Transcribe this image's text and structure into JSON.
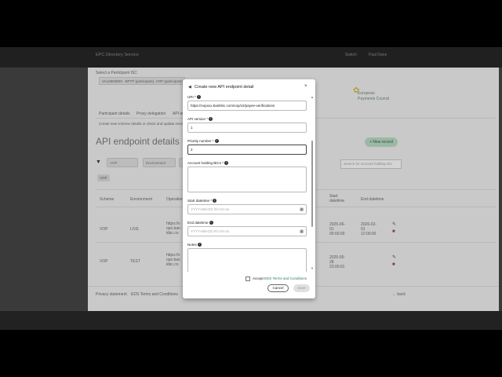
{
  "app": {
    "title": "EPC Directory Service",
    "user_switch": "Switch",
    "user_name": "Paul Dane",
    "brand_line1": "European",
    "brand_line2": "Payments Council"
  },
  "background": {
    "participant_label": "Select a Participant ISC",
    "participant_value": "VAL5903800 - BFTP (participant), VOP (participant)",
    "tabs": [
      "Participant details",
      "Proxy delegation",
      "API endpoints"
    ],
    "description": "Create new scheme details or check and update existing ones",
    "page_title": "API endpoint details (2)",
    "new_record": "+ New record",
    "filters": [
      "VOP",
      "Environment",
      "..."
    ],
    "chip": "VOP",
    "search_placeholder": "Search for account holding ISC",
    "columns": [
      "Scheme",
      "Environment",
      "Operation",
      "Start datetime",
      "End datetime"
    ],
    "rows": [
      {
        "scheme": "VOP",
        "env": "LIVE",
        "url": "https://vopx.bankbic.com/vop/v2/payee-verifications",
        "start": "2025-06-01 00:00:00",
        "end": "2026-02-01 12:00:00"
      },
      {
        "scheme": "VOP",
        "env": "TEST",
        "url": "https://vopx.bankbic.com/vop/v2/payee-verifications",
        "start": "2025-05-28 23:00:01",
        "end": ""
      }
    ],
    "footer_privacy": "Privacy statement",
    "footer_terms": "EDS Terms and Conditions",
    "back": "← back"
  },
  "modal": {
    "title": "Create new API endpoint detail",
    "close": "×",
    "url_label": "URI *",
    "url_value": "https://vopxxx.bankbic.com/vop/v2/payee-verifications",
    "api_version_label": "API version *",
    "api_version_value": "1",
    "priority_label": "Priority number *",
    "priority_value": "2",
    "account_bics_label": "Account holding BICs *",
    "start_label": "Start datetime *",
    "start_placeholder": "YYYY-MM-DD hh:mm:ss",
    "end_label": "End datetime",
    "end_placeholder": "YYYY-MM-DD hh:mm:ss",
    "notes_label": "Notes",
    "accept_text": "Accept",
    "terms_link": "EDS Terms and Conditions",
    "cancel": "Cancel",
    "save": "Save"
  }
}
